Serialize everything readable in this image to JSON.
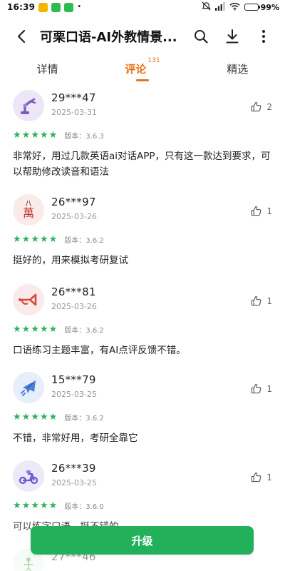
{
  "status_bar": {
    "time": "16:39",
    "dot": "•",
    "battery": "99%",
    "battery_level": 0.99
  },
  "header": {
    "back_icon": "back-arrow-icon",
    "title": "可栗口语-AI外教情景...",
    "actions": [
      "search-icon",
      "download-icon",
      "more-icon"
    ]
  },
  "tabs": [
    {
      "label": "详情",
      "active": false
    },
    {
      "label": "评论",
      "count": "131",
      "active": true
    },
    {
      "label": "精选",
      "active": false
    }
  ],
  "reviews": [
    {
      "user": "29***47",
      "date": "2025-03-31",
      "likes": "2",
      "stars": 5,
      "version": "版本：3.6.3",
      "comment": "非常好，用过几款英语ai对话APP，只有这一款达到要求，可以帮助修改读音和语法",
      "avatar_color": "#ece6f7",
      "avatar_icon": "robot-arm-icon"
    },
    {
      "user": "26***97",
      "date": "2025-03-26",
      "likes": "1",
      "stars": 5,
      "version": "版本：3.6.2",
      "comment": "挺好的，用来模拟考研复试",
      "avatar_color": "#fbeaea",
      "avatar_icon": "wan-character-icon",
      "avatar_text_top": "八",
      "avatar_text_main": "萬"
    },
    {
      "user": "26***81",
      "date": "2025-03-26",
      "likes": "1",
      "stars": 5,
      "version": "版本：3.6.2",
      "comment": "口语练习主题丰富，有AI点评反馈不错。",
      "avatar_color": "#fbeaea",
      "avatar_icon": "trumpet-icon"
    },
    {
      "user": "15***79",
      "date": "2025-03-25",
      "likes": "1",
      "stars": 5,
      "version": "版本：3.6.2",
      "comment": "不错，非常好用，考研全靠它",
      "avatar_color": "#e7eefb",
      "avatar_icon": "jet-plane-icon"
    },
    {
      "user": "26***39",
      "date": "2025-03-25",
      "likes": "1",
      "stars": 5,
      "version": "版本：3.6.0",
      "comment": "可以练字口语，挺不错的",
      "avatar_color": "#ece9f8",
      "avatar_icon": "scooter-icon"
    },
    {
      "user": "27***46",
      "date": "",
      "likes": "",
      "stars": 0,
      "version": "",
      "comment": "",
      "avatar_color": "#eef7ee",
      "avatar_icon": "figure-icon"
    }
  ],
  "upgrade_button": {
    "label": "升级",
    "color": "#22b15a"
  },
  "colors": {
    "accent": "#e8731a",
    "star": "#2cb35a"
  }
}
